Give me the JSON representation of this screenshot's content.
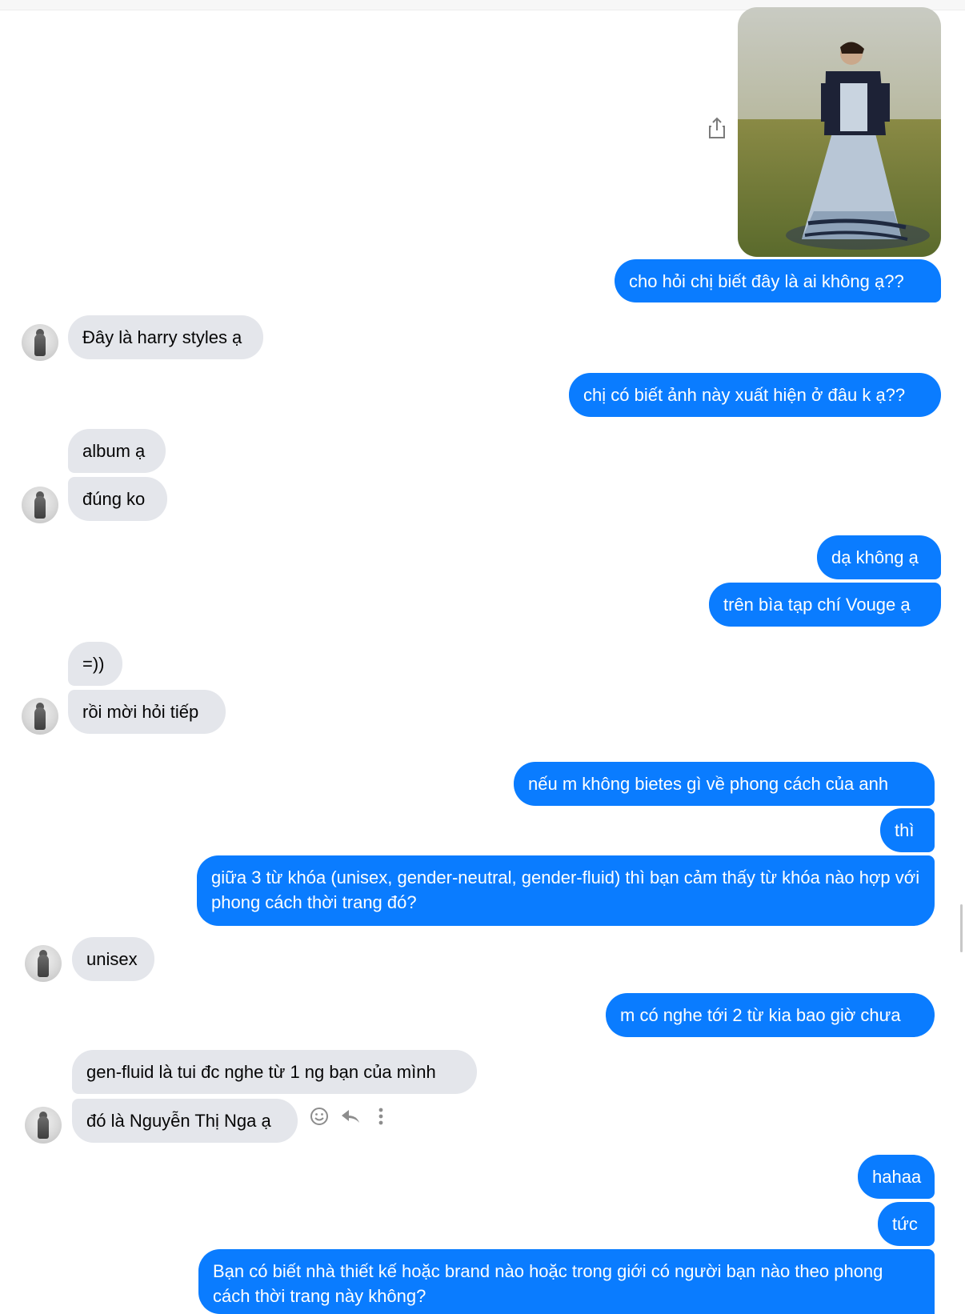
{
  "conversation": {
    "m1": "cho hỏi chị biết đây là ai không ạ??",
    "m2": "Đây là harry styles ạ",
    "m3": "chị có biết ảnh này xuất hiện ở đâu k ạ??",
    "m4": "album ạ",
    "m5": "đúng ko",
    "m6": "dạ không ạ",
    "m7": "trên bìa tạp chí Vouge ạ",
    "m8": "=))",
    "m9": "rồi mời hỏi tiếp",
    "m10": "nếu m không bietes gì về phong cách của anh",
    "m11": "thì",
    "m12": "giữa 3 từ khóa (unisex, gender-neutral, gender-fluid) thì bạn cảm thấy từ khóa nào hợp với phong cách thời trang đó?",
    "m13": "unisex",
    "m14": "m có nghe tới 2 từ kia bao giờ chưa",
    "m15": "gen-fluid là tui đc nghe từ 1 ng bạn của mình",
    "m16": "đó là Nguyễn Thị Nga ạ",
    "m17": "hahaa",
    "m18": "tức",
    "m19": "Bạn có biết nhà thiết kế hoặc brand nào hoặc trong giới có người bạn nào theo phong cách thời trang này không?"
  },
  "icons": {
    "share": "share-icon",
    "react": "smiley-icon",
    "reply": "reply-icon",
    "more": "more-vertical-icon"
  },
  "colors": {
    "outgoing_bubble": "#0a7cff",
    "incoming_bubble": "#e4e6eb"
  }
}
